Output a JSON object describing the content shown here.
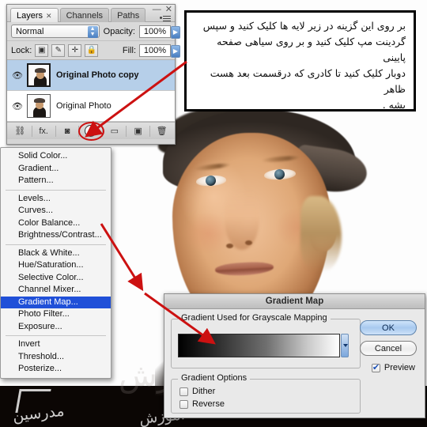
{
  "layers_panel": {
    "tabs": [
      {
        "label": "Layers",
        "close": "✕",
        "active": true
      },
      {
        "label": "Channels",
        "active": false
      },
      {
        "label": "Paths",
        "active": false
      }
    ],
    "window_controls": {
      "minimize": "—",
      "close": "✕"
    },
    "blend_mode": "Normal",
    "opacity_label": "Opacity:",
    "opacity_value": "100%",
    "lock_label": "Lock:",
    "lock_buttons": [
      "transparent-pixels",
      "image-pixels",
      "position",
      "all"
    ],
    "lock_glyphs": [
      "▣",
      "✎",
      "✛",
      "🔒"
    ],
    "fill_label": "Fill:",
    "fill_value": "100%",
    "layers": [
      {
        "name": "Original Photo copy",
        "visible": true,
        "selected": true
      },
      {
        "name": "Original Photo",
        "visible": false,
        "selected": false
      }
    ],
    "eye_glyph": "👁",
    "footer_icons": [
      {
        "name": "link-layers",
        "glyph": "⛓"
      },
      {
        "name": "layer-style-fx",
        "glyph": "fx."
      },
      {
        "name": "layer-mask",
        "glyph": "◙"
      },
      {
        "name": "new-adjustment-layer",
        "glyph": ""
      },
      {
        "name": "new-group",
        "glyph": "▭"
      },
      {
        "name": "new-layer",
        "glyph": "▣"
      },
      {
        "name": "delete-layer",
        "glyph": "🗑"
      }
    ]
  },
  "adjustment_menu": {
    "groups": [
      [
        "Solid Color...",
        "Gradient...",
        "Pattern..."
      ],
      [
        "Levels...",
        "Curves...",
        "Color Balance...",
        "Brightness/Contrast..."
      ],
      [
        "Black & White...",
        "Hue/Saturation...",
        "Selective Color...",
        "Channel Mixer...",
        "Gradient Map...",
        "Photo Filter...",
        "Exposure..."
      ],
      [
        "Invert",
        "Threshold...",
        "Posterize..."
      ]
    ],
    "highlighted": "Gradient Map..."
  },
  "callout": {
    "lines": [
      "بر روی این گزینه در زیر لایه ها کلیک کنید  و سپس",
      "گردینت مپ کلیک کنید و بر روی سیاهی صفحه پایینی",
      "دوبار کلیک کنید تا کادری که درقسمت بعد هست  ظاهر",
      "بشه ."
    ]
  },
  "gradient_map_dialog": {
    "title": "Gradient Map",
    "group_legend": "Gradient Used for Grayscale Mapping",
    "options_legend": "Gradient Options",
    "checkboxes": [
      {
        "label": "Dither",
        "checked": false
      },
      {
        "label": "Reverse",
        "checked": false
      }
    ],
    "buttons": [
      {
        "label": "OK",
        "primary": true
      },
      {
        "label": "Cancel",
        "primary": false
      }
    ],
    "preview": {
      "label": "Preview",
      "checked": true
    },
    "gradient": {
      "from": "#000000",
      "to": "#ffffff"
    }
  },
  "watermarks": {
    "left": "مدرسین",
    "middle": "آموزش",
    "right": "آموزش"
  },
  "colors": {
    "highlight_blue": "#2050d8",
    "selection_blue": "#b6cfe9",
    "arrow_red": "#cc1111",
    "panel_gray": "#d5d5d5"
  }
}
